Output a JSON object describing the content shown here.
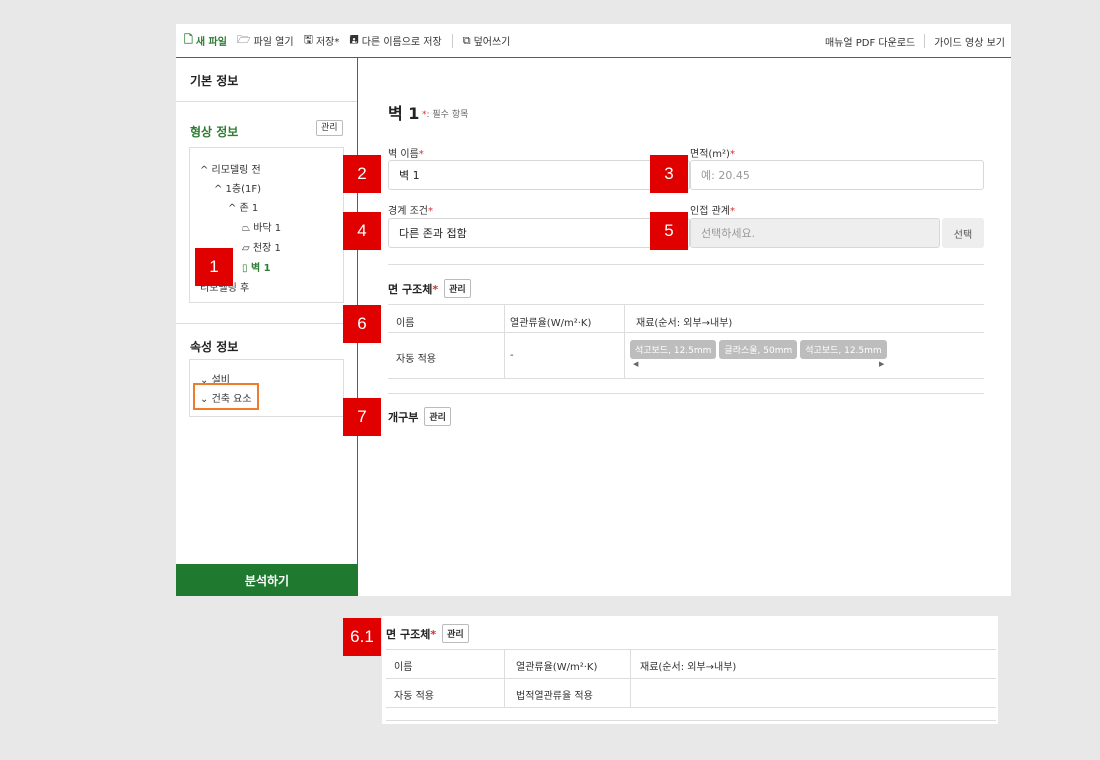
{
  "toolbar": {
    "new_file": "새 파일",
    "open_file": "파일 열기",
    "save": "저장*",
    "save_as": "다른 이름으로 저장",
    "overwrite": "덮어쓰기",
    "manual_pdf": "매뉴얼 PDF 다운로드",
    "guide_video": "가이드 영상 보기"
  },
  "sidebar": {
    "basic_info": "기본 정보",
    "shape_info": "형상 정보",
    "manage": "관리",
    "tree": {
      "before": "^ 리모델링 전",
      "floor": "^ 1층(1F)",
      "zone": "^ 존 1",
      "floor_surface": "바닥 1",
      "ceiling": "천장 1",
      "wall": "벽 1",
      "after": "리모델링 후"
    },
    "property_info": "속성 정보",
    "props": {
      "equipment": "설비",
      "building": "건축 요소"
    },
    "analyze": "분석하기"
  },
  "form": {
    "title": "벽 1",
    "required_star": "*",
    "required_note": ": 필수 항목",
    "wall_name_label": "벽 이름",
    "wall_name_value": "벽 1",
    "area_label": "면적(m²)",
    "area_placeholder": "예: 20.45",
    "boundary_label": "경계 조건",
    "boundary_value": "다른 존과 접함",
    "adjacent_label": "인접 관계",
    "adjacent_placeholder": "선택하세요.",
    "select_btn": "선택",
    "surface_title": "면 구조체",
    "opening_title": "개구부"
  },
  "table": {
    "headers": [
      "이름",
      "열관류율(W/m²·K)",
      "재료(순서: 외부→내부)"
    ],
    "row_name": "자동 적용",
    "row_u": "-",
    "chips": [
      "석고보드, 12.5mm",
      "글라스울, 50mm",
      "석고보드, 12.5mm"
    ]
  },
  "table2": {
    "title": "면 구조체",
    "headers": [
      "이름",
      "열관류율(W/m²·K)",
      "재료(순서: 외부→내부)"
    ],
    "row_name": "자동 적용",
    "row_u": "법적열관류율 적용"
  },
  "markers": [
    "1",
    "2",
    "3",
    "4",
    "5",
    "6",
    "7",
    "6.1"
  ],
  "colors": {
    "accent": "#2e7d32",
    "marker": "#e00000",
    "highlight": "#f07b2b"
  }
}
